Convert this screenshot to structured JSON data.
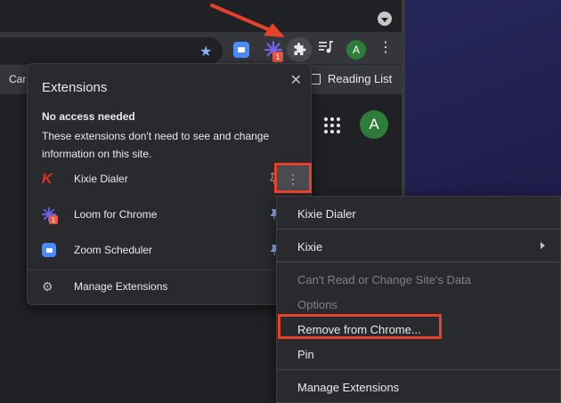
{
  "toolbar": {
    "star_icon": "star-icon",
    "zoom_icon": "zoom-icon",
    "loom_badge": "1",
    "puzzle_icon": "puzzle-icon",
    "playlist_icon": "playlist-icon",
    "avatar_letter": "A",
    "menu_icon": "kebab-menu-icon"
  },
  "bookmarks": {
    "partial_item": "Car",
    "reading_list": "Reading List"
  },
  "page": {
    "avatar_letter": "A"
  },
  "extensions_popup": {
    "title": "Extensions",
    "close_icon": "close-icon",
    "section_heading": "No access needed",
    "section_desc": "These extensions don't need to see and change information on this site.",
    "items": [
      {
        "name": "Kixie Dialer",
        "pinned": false
      },
      {
        "name": "Loom for Chrome",
        "pinned": true,
        "badge": "1"
      },
      {
        "name": "Zoom Scheduler",
        "pinned": true
      }
    ],
    "manage_label": "Manage Extensions"
  },
  "context_menu": {
    "items": [
      {
        "label": "Kixie Dialer",
        "enabled": true
      },
      {
        "label": "Kixie",
        "enabled": true,
        "submenu": true
      },
      {
        "label": "Can't Read or Change Site's Data",
        "enabled": false
      },
      {
        "label": "Options",
        "enabled": false
      },
      {
        "label": "Remove from Chrome...",
        "enabled": true
      },
      {
        "label": "Pin",
        "enabled": true
      },
      {
        "label": "Manage Extensions",
        "enabled": true
      }
    ]
  },
  "colors": {
    "highlight": "#e8412b",
    "popup_bg": "#292a2d",
    "accent_blue": "#8ab4f8",
    "avatar_green": "#2d7d3a"
  }
}
